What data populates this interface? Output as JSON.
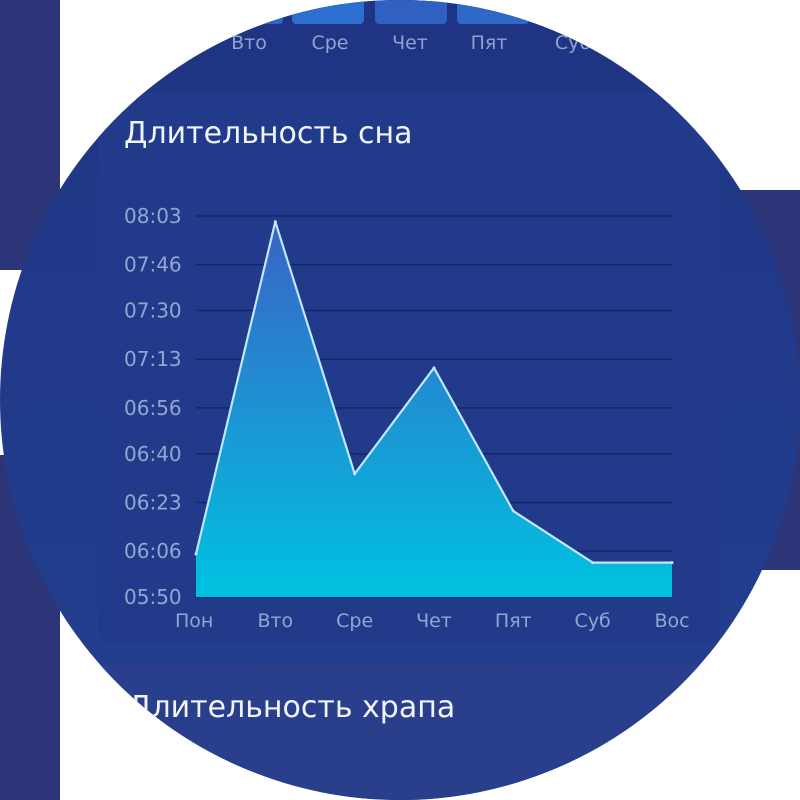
{
  "top_days": [
    "Вто",
    "Сре",
    "Чет",
    "Пят",
    "Суб"
  ],
  "sleep_card": {
    "title": "Длительность сна"
  },
  "snore_card": {
    "title": "Длительность храпа"
  },
  "colors": {
    "fill_top": "#3a63c6",
    "fill_bottom": "#00c2e0",
    "line": "#bfe8ff",
    "grid": "#14266a",
    "tick_text": "#93a5d0"
  },
  "chart_data": {
    "type": "area",
    "title": "Длительность сна",
    "xlabel": "",
    "ylabel": "",
    "categories": [
      "Пон",
      "Вто",
      "Сре",
      "Чет",
      "Пят",
      "Суб",
      "Вос"
    ],
    "y_ticks": [
      "05:50",
      "06:06",
      "06:23",
      "06:40",
      "06:56",
      "07:13",
      "07:30",
      "07:46",
      "08:03"
    ],
    "ylim": [
      "05:50",
      "08:03"
    ],
    "grid": true,
    "series": [
      {
        "values": [
          "06:05",
          "08:01",
          "06:33",
          "07:10",
          "06:20",
          "06:02",
          "06:02"
        ]
      }
    ]
  }
}
